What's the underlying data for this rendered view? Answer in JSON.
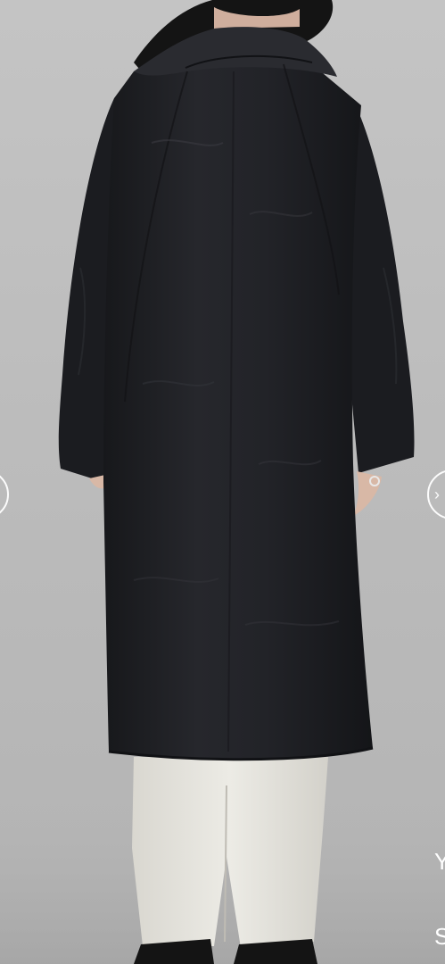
{
  "viewer": {
    "prev_icon": "chevron-left-icon",
    "next_icon": "chevron-right-icon",
    "prev_glyph": "‹",
    "next_glyph": "›",
    "side_text_top": "Y",
    "side_text_bottom": "S"
  },
  "colors": {
    "backdrop": "#bcbcbc",
    "coat": "#1f2024",
    "pants": "#e6e4dd",
    "hair": "#141414",
    "skin": "#d8b8a6"
  }
}
